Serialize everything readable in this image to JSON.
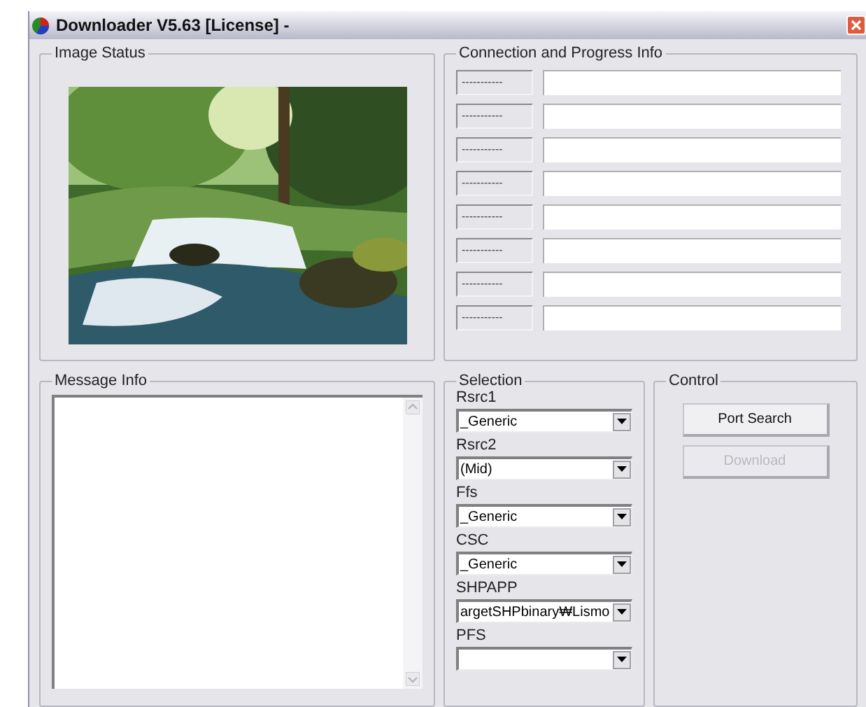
{
  "window": {
    "title": "Downloader V5.63 [License] -"
  },
  "image_status": {
    "title": "Image Status"
  },
  "connection": {
    "title": "Connection and Progress Info",
    "rows": [
      {
        "label": "-----------"
      },
      {
        "label": "-----------"
      },
      {
        "label": "-----------"
      },
      {
        "label": "-----------"
      },
      {
        "label": "-----------"
      },
      {
        "label": "-----------"
      },
      {
        "label": "-----------"
      },
      {
        "label": "-----------"
      }
    ]
  },
  "message_info": {
    "title": "Message Info"
  },
  "selection": {
    "title": "Selection",
    "fields": [
      {
        "label": "Rsrc1",
        "value": "_Generic"
      },
      {
        "label": "Rsrc2",
        "value": "(Mid)"
      },
      {
        "label": "Ffs",
        "value": "_Generic"
      },
      {
        "label": "CSC",
        "value": "_Generic"
      },
      {
        "label": "SHPAPP",
        "value": "argetSHPbinary₩Lismo"
      },
      {
        "label": "PFS"
      }
    ]
  },
  "control": {
    "title": "Control",
    "buttons": [
      {
        "label": "Port Search",
        "disabled": false
      },
      {
        "label": "Download",
        "disabled": true
      }
    ]
  }
}
